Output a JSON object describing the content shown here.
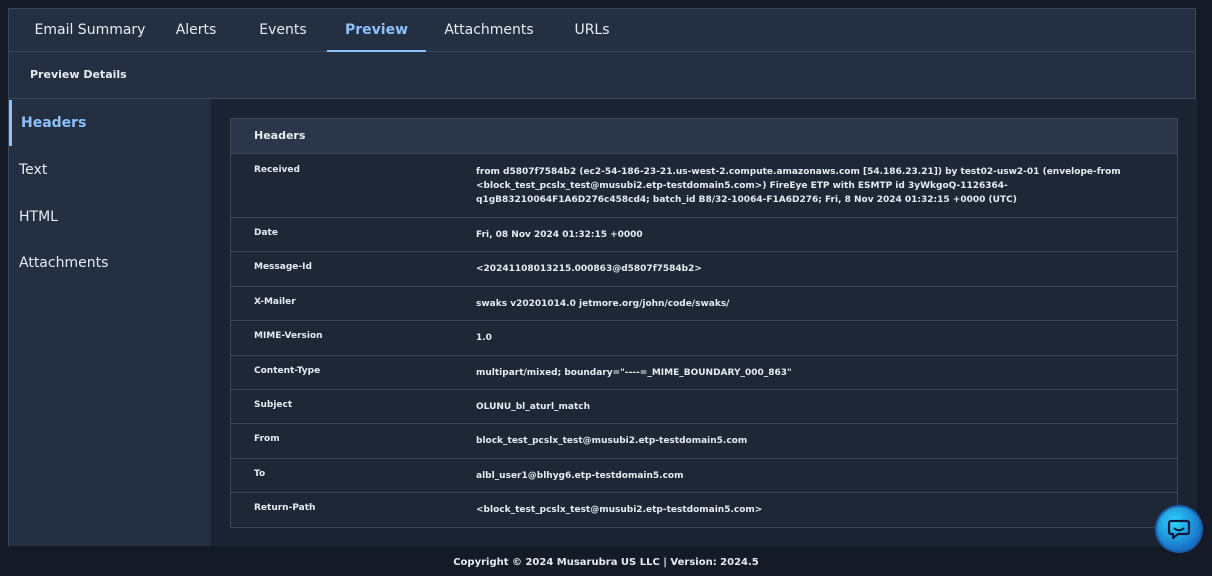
{
  "tabs": [
    {
      "label": "Email Summary",
      "active": false
    },
    {
      "label": "Alerts",
      "active": false
    },
    {
      "label": "Events",
      "active": false
    },
    {
      "label": "Preview",
      "active": true
    },
    {
      "label": "Attachments",
      "active": false
    },
    {
      "label": "URLs",
      "active": false
    }
  ],
  "subheader": {
    "title": "Preview Details"
  },
  "sidebar": {
    "items": [
      {
        "label": "Headers",
        "active": true
      },
      {
        "label": "Text",
        "active": false
      },
      {
        "label": "HTML",
        "active": false
      },
      {
        "label": "Attachments",
        "active": false
      }
    ]
  },
  "headers_panel": {
    "title": "Headers",
    "rows": [
      {
        "key": "Received",
        "value": "from d5807f7584b2 (ec2-54-186-23-21.us-west-2.compute.amazonaws.com [54.186.23.21]) by test02-usw2-01 (envelope-from <block_test_pcslx_test@musubi2.etp-testdomain5.com>) FireEye ETP with ESMTP id 3yWkgoQ-1126364-q1gB83210064F1A6D276c458cd4; batch_id B8/32-10064-F1A6D276; Fri, 8 Nov 2024 01:32:15 +0000 (UTC)"
      },
      {
        "key": "Date",
        "value": "Fri, 08 Nov 2024 01:32:15 +0000"
      },
      {
        "key": "Message-Id",
        "value": "<20241108013215.000863@d5807f7584b2>"
      },
      {
        "key": "X-Mailer",
        "value": "swaks v20201014.0 jetmore.org/john/code/swaks/"
      },
      {
        "key": "MIME-Version",
        "value": "1.0"
      },
      {
        "key": "Content-Type",
        "value": "multipart/mixed; boundary=\"----=_MIME_BOUNDARY_000_863\""
      },
      {
        "key": "Subject",
        "value": "OLUNU_bl_aturl_match"
      },
      {
        "key": "From",
        "value": "block_test_pcslx_test@musubi2.etp-testdomain5.com"
      },
      {
        "key": "To",
        "value": "albl_user1@blhyg6.etp-testdomain5.com"
      },
      {
        "key": "Return-Path",
        "value": "<block_test_pcslx_test@musubi2.etp-testdomain5.com>"
      }
    ]
  },
  "footer": {
    "text": "Copyright © 2024 Musarubra US LLC | Version: 2024.5"
  },
  "chat": {
    "icon": "chat-icon"
  },
  "colors": {
    "accent": "#8cc0ff",
    "background": "#1b2432",
    "panel": "#243042"
  }
}
